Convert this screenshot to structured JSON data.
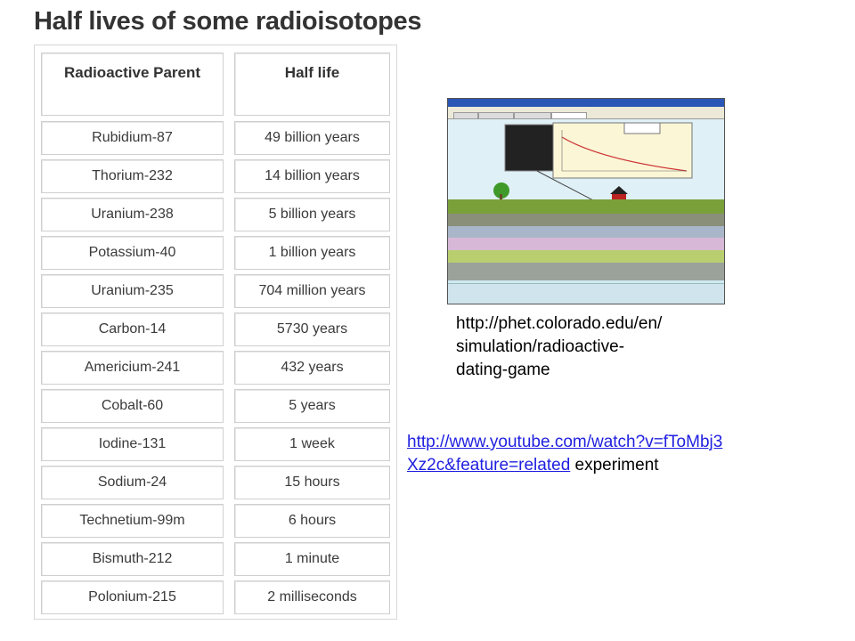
{
  "title": "Half lives of some radioisotopes",
  "table": {
    "headers": [
      "Radioactive Parent",
      "Half life"
    ],
    "rows": [
      [
        "Rubidium-87",
        "49 billion years"
      ],
      [
        "Thorium-232",
        "14 billion years"
      ],
      [
        "Uranium-238",
        "5 billion years"
      ],
      [
        "Potassium-40",
        "1 billion years"
      ],
      [
        "Uranium-235",
        "704 million years"
      ],
      [
        "Carbon-14",
        "5730 years"
      ],
      [
        "Americium-241",
        "432 years"
      ],
      [
        "Cobalt-60",
        "5 years"
      ],
      [
        "Iodine-131",
        "1 week"
      ],
      [
        "Sodium-24",
        "15 hours"
      ],
      [
        "Technetium-99m",
        "6 hours"
      ],
      [
        "Bismuth-212",
        "1 minute"
      ],
      [
        "Polonium-215",
        "2 milliseconds"
      ]
    ]
  },
  "phet_caption": "http://phet.colorado.edu/en/\nsimulation/radioactive-\ndating-game",
  "youtube": {
    "link_line1": "http://www.youtube.com/watch?v=fToMbj3",
    "link_line2": "Xz2c&feature=related",
    "suffix": " experiment"
  },
  "colors": {
    "link": "#1f1fe0",
    "cell_border": "#cfcfcf"
  }
}
